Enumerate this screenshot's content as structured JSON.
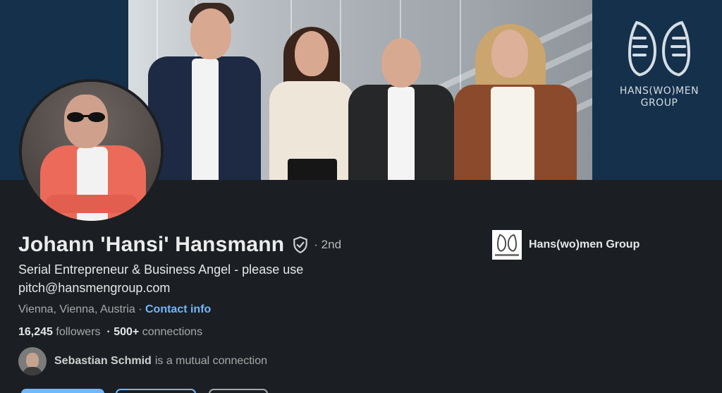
{
  "banner": {
    "brand_text_line1": "HANS(WO)MEN",
    "brand_text_line2": "GROUP",
    "brand_icon": "wings-logo-icon",
    "background_color": "#15304a"
  },
  "profile": {
    "name": "Johann 'Hansi' Hansmann",
    "verified_icon": "shield-check-icon",
    "degree": "· 2nd",
    "headline": "Serial Entrepreneur & Business Angel - please use pitch@hansmengroup.com",
    "location": "Vienna, Vienna, Austria ·",
    "contact_info_label": "Contact info",
    "followers_count": "16,245",
    "followers_label": "followers",
    "connections_count": "· 500+",
    "connections_label": "connections",
    "mutual": {
      "name": "Sebastian Schmid",
      "suffix": "is a mutual connection"
    }
  },
  "company": {
    "name": "Hans(wo)men Group",
    "logo_icon": "company-logo-icon"
  },
  "colors": {
    "background": "#1b1f23",
    "link": "#71b7fb",
    "text_primary": "#e6e6e6",
    "text_secondary": "#a8a8a8"
  }
}
